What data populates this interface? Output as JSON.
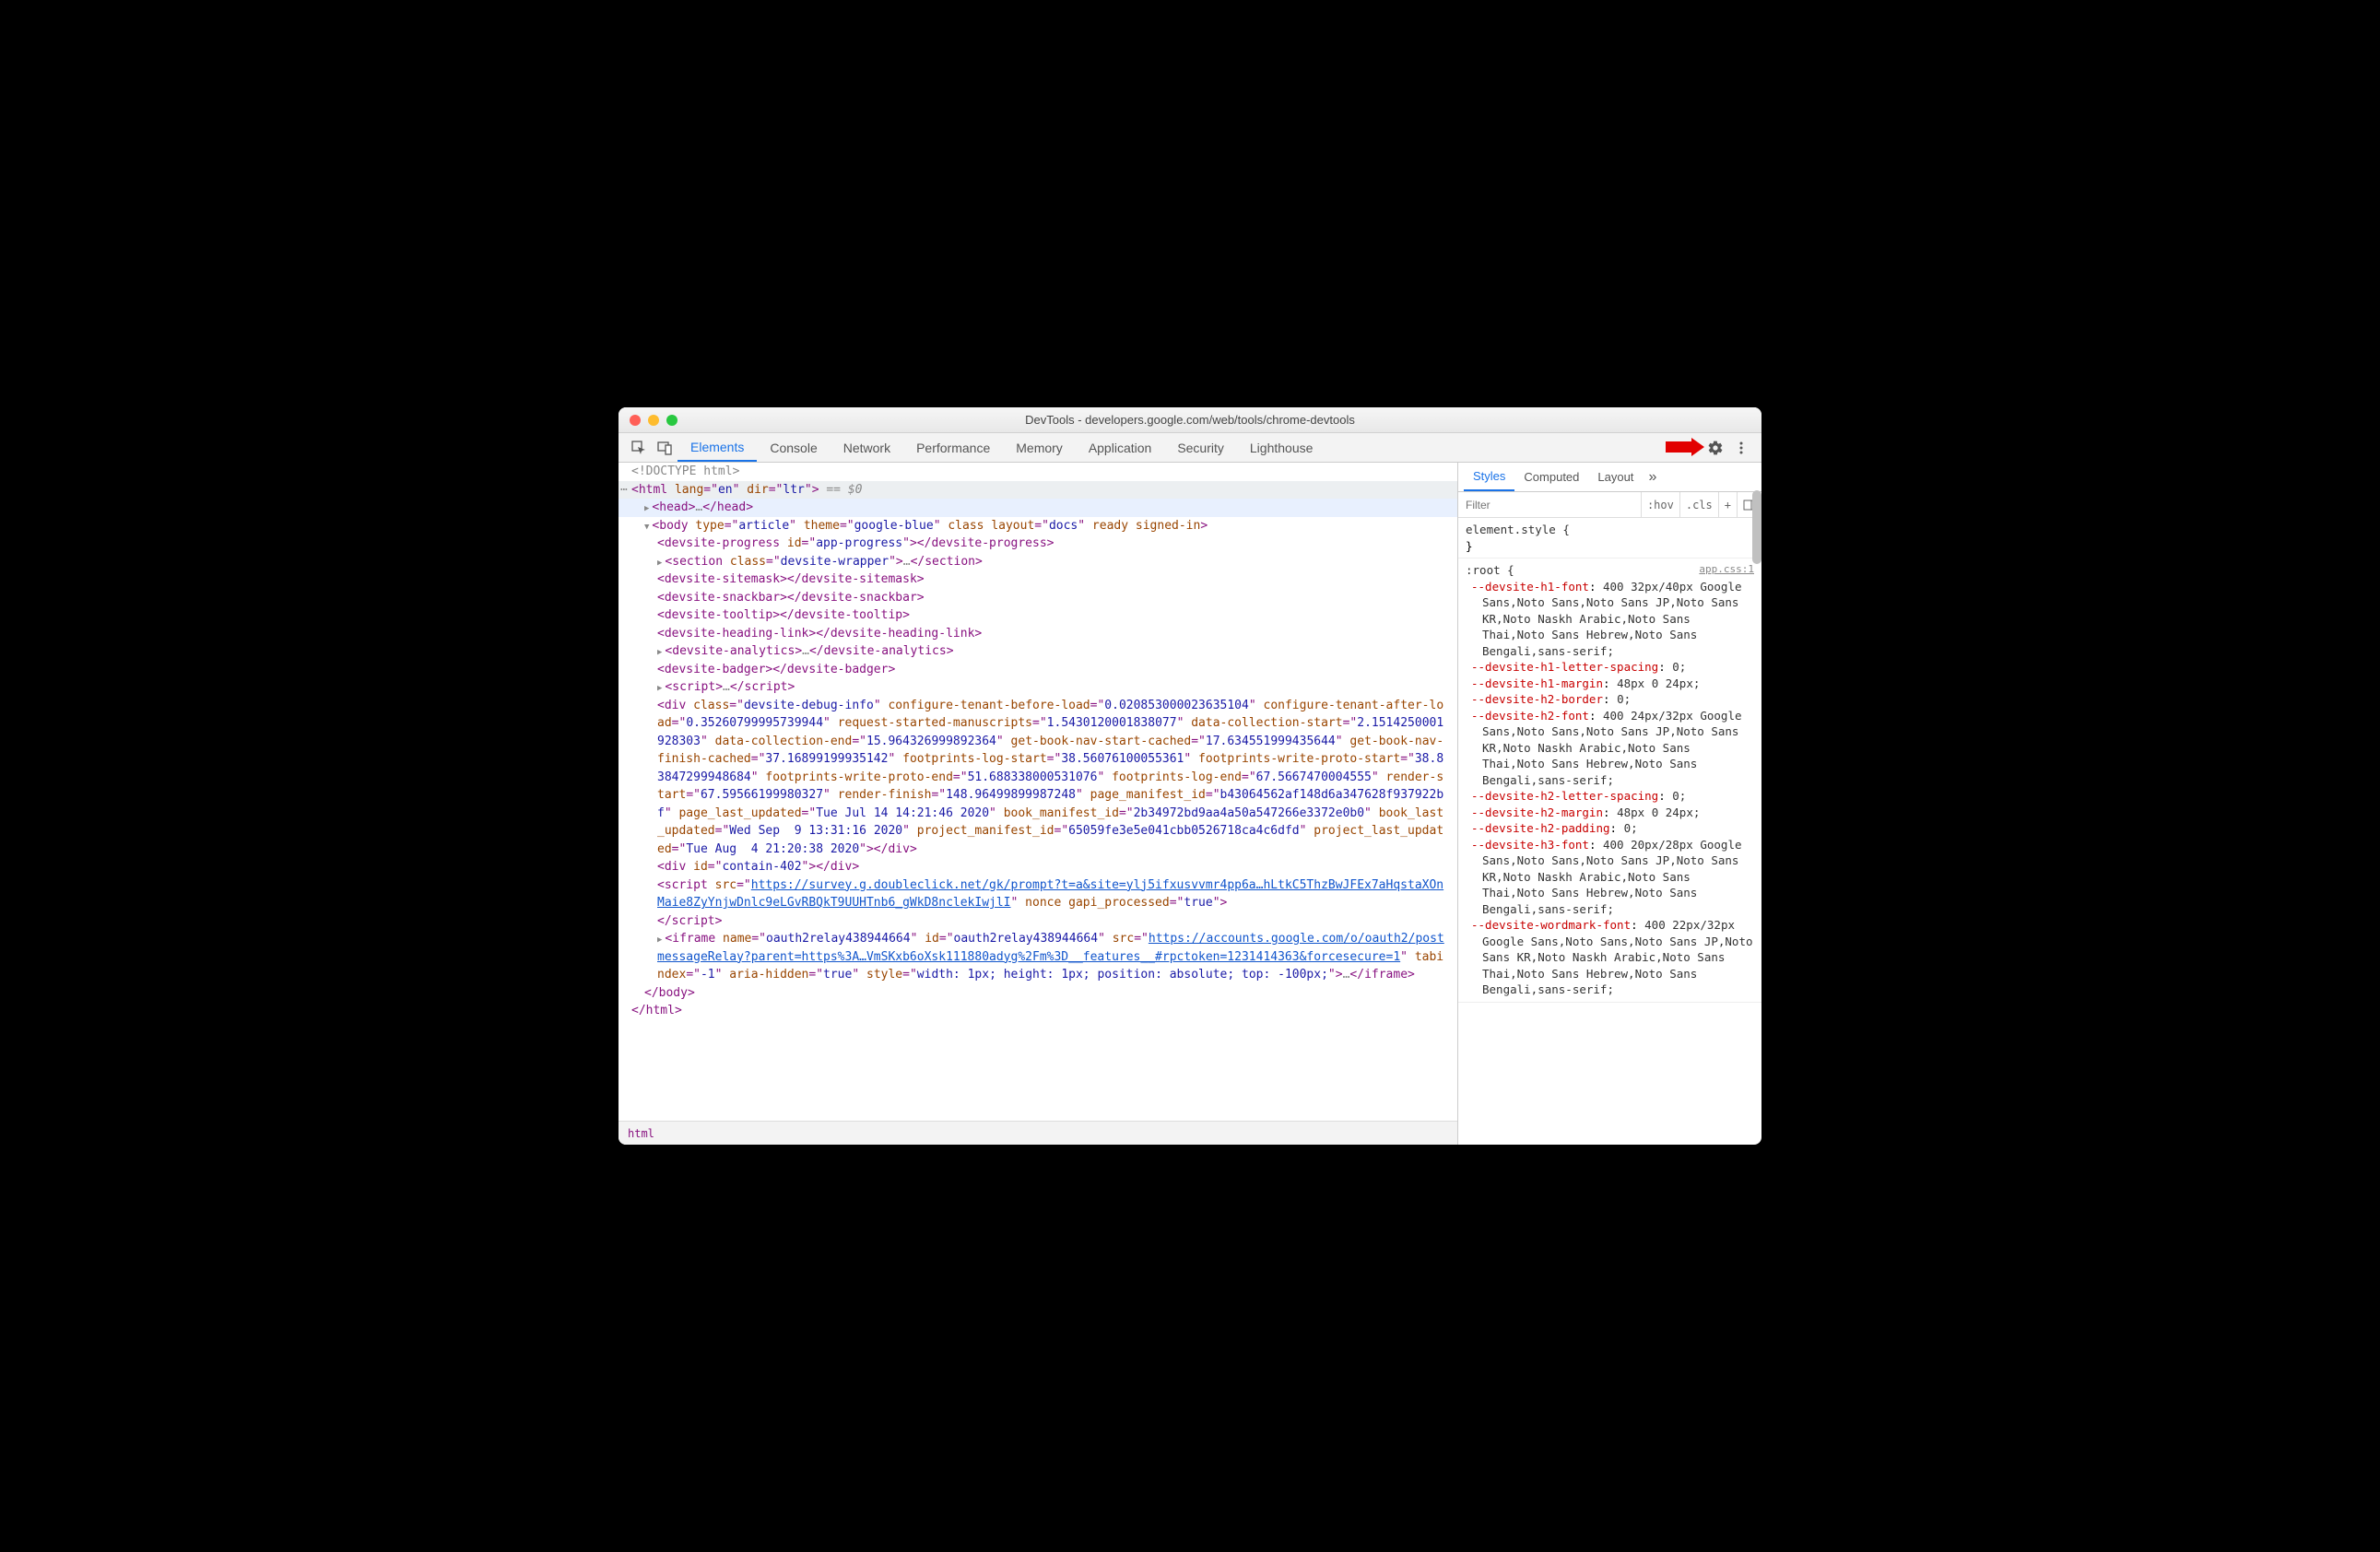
{
  "window": {
    "title": "DevTools - developers.google.com/web/tools/chrome-devtools"
  },
  "tabs": [
    "Elements",
    "Console",
    "Network",
    "Performance",
    "Memory",
    "Application",
    "Security",
    "Lighthouse"
  ],
  "activeTab": "Elements",
  "breadcrumb": "html",
  "dom": {
    "doctype": "<!DOCTYPE html>",
    "htmlLine": "<html lang=\"en\" dir=\"ltr\"> == $0",
    "selectedSuffix": "$0"
  },
  "stylesTabs": [
    "Styles",
    "Computed",
    "Layout"
  ],
  "activeStylesTab": "Styles",
  "filter": {
    "placeholder": "Filter",
    "hov": ":hov",
    "cls": ".cls"
  },
  "rules": {
    "elementStyle": "element.style {",
    "rootSelector": ":root {",
    "rootSource": "app.css:1"
  },
  "cssProps": [
    {
      "name": "--devsite-h1-font",
      "val": "400 32px/40px Google Sans,Noto Sans,Noto Sans JP,Noto Sans KR,Noto Naskh Arabic,Noto Sans Thai,Noto Sans Hebrew,Noto Sans Bengali,sans-serif;"
    },
    {
      "name": "--devsite-h1-letter-spacing",
      "val": "0;"
    },
    {
      "name": "--devsite-h1-margin",
      "val": "48px 0 24px;"
    },
    {
      "name": "--devsite-h2-border",
      "val": "0;"
    },
    {
      "name": "--devsite-h2-font",
      "val": "400 24px/32px Google Sans,Noto Sans,Noto Sans JP,Noto Sans KR,Noto Naskh Arabic,Noto Sans Thai,Noto Sans Hebrew,Noto Sans Bengali,sans-serif;"
    },
    {
      "name": "--devsite-h2-letter-spacing",
      "val": "0;"
    },
    {
      "name": "--devsite-h2-margin",
      "val": "48px 0 24px;"
    },
    {
      "name": "--devsite-h2-padding",
      "val": "0;"
    },
    {
      "name": "--devsite-h3-font",
      "val": "400 20px/28px Google Sans,Noto Sans,Noto Sans JP,Noto Sans KR,Noto Naskh Arabic,Noto Sans Thai,Noto Sans Hebrew,Noto Sans Bengali,sans-serif;"
    },
    {
      "name": "--devsite-wordmark-font",
      "val": "400 22px/32px Google Sans,Noto Sans,Noto Sans JP,Noto Sans KR,Noto Naskh Arabic,Noto Sans Thai,Noto Sans Hebrew,Noto Sans Bengali,sans-serif;"
    }
  ],
  "domAttrs": {
    "body": {
      "type": "article",
      "theme": "google-blue",
      "layout": "docs",
      "class": "",
      "extra": "ready signed-in"
    },
    "progress": {
      "id": "app-progress"
    },
    "section": {
      "class": "devsite-wrapper"
    },
    "debugDiv": {
      "class": "devsite-debug-info",
      "configure-tenant-before-load": "0.020853000023635104",
      "configure-tenant-after-load": "0.35260799995739944",
      "request-started-manuscripts": "1.5430120001838077",
      "data-collection-start": "2.1514250001928303",
      "data-collection-end": "15.964326999892364",
      "get-book-nav-start-cached": "17.634551999435644",
      "get-book-nav-finish-cached": "37.16899199935142",
      "footprints-log-start": "38.56076100055361",
      "footprints-write-proto-start": "38.83847299948684",
      "footprints-write-proto-end": "51.688338000531076",
      "footprints-log-end": "67.5667470004555",
      "render-start": "67.59566199980327",
      "render-finish": "148.96499899987248",
      "page_manifest_id": "b43064562af148d6a347628f937922bf",
      "page_last_updated": "Tue Jul 14 14:21:46 2020",
      "book_manifest_id": "2b34972bd9aa4a50a547266e3372e0b0",
      "book_last_updated": "Wed Sep  9 13:31:16 2020",
      "project_manifest_id": "65059fe3e5e041cbb0526718ca4c6dfd",
      "project_last_updated": "Tue Aug  4 21:20:38 2020"
    },
    "containDiv": {
      "id": "contain-402"
    },
    "surveyScript": {
      "src": "https://survey.g.doubleclick.net/gk/prompt?t=a&site=ylj5ifxusvvmr4pp6a…hLtkC5ThzBwJFEx7aHqstaXOnMaie8ZyYnjwDnlc9eLGvRBQkT9UUHTnb6_gWkD8nclekIwjlI",
      "nonce": "",
      "gapi_processed": "true"
    },
    "iframe": {
      "name": "oauth2relay438944664",
      "id": "oauth2relay438944664",
      "src": "https://accounts.google.com/o/oauth2/postmessageRelay?parent=https%3A…VmSKxb6oXsk111880adyg%2Fm%3D__features__#rpctoken=1231414363&forcesecure=1",
      "tabindex": "-1",
      "aria-hidden": "true",
      "style": "width: 1px; height: 1px; position: absolute; top: -100px;"
    }
  }
}
